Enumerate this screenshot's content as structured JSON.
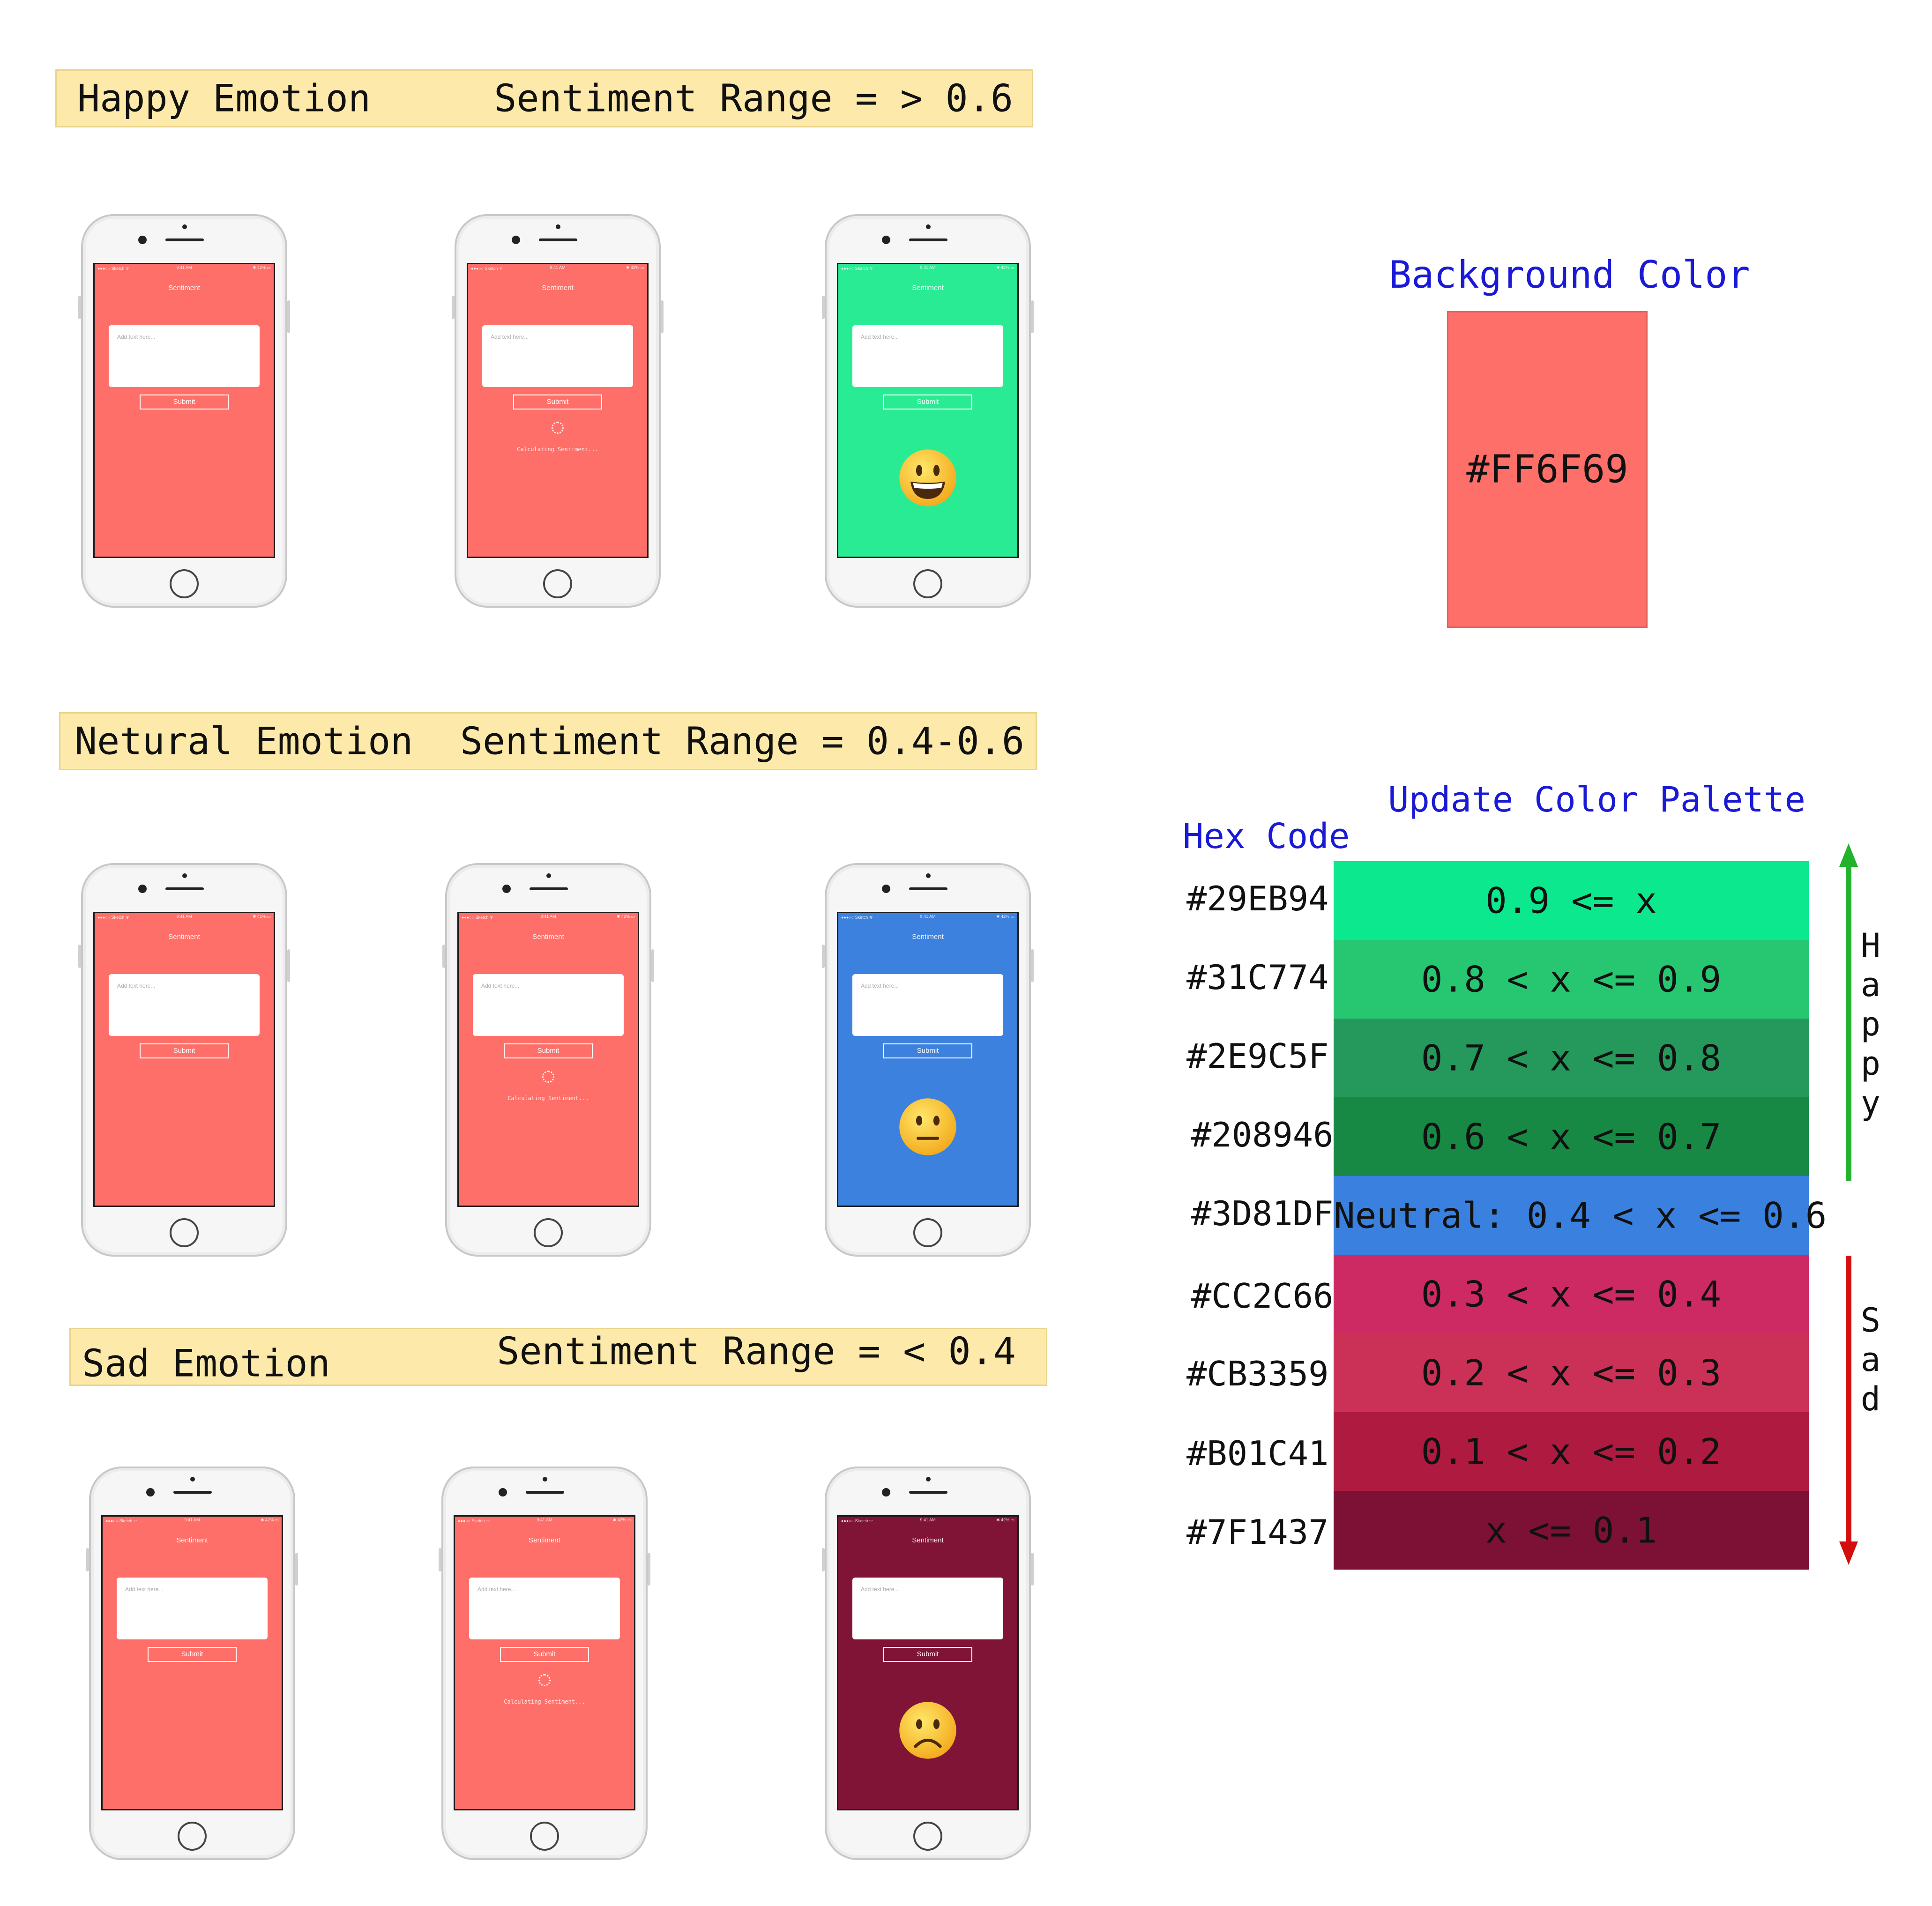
{
  "banners": {
    "happy": {
      "left": "Happy Emotion",
      "right": "Sentiment Range = > 0.6"
    },
    "neutral": {
      "left": "Netural Emotion",
      "right": "Sentiment Range = 0.4-0.6"
    },
    "sad": {
      "left": "Sad Emotion",
      "right": "Sentiment Range = < 0.4"
    }
  },
  "phone_ui": {
    "status_left": "●●●○○ Sketch ᯤ",
    "status_center": "9:41 AM",
    "status_right": "✱ 42% ▭",
    "app_title": "Sentiment",
    "placeholder": "Add text here...",
    "submit_label": "Submit",
    "calculating_text": "Calculating Sentiment..."
  },
  "colors": {
    "default_bg": "#FF6F69",
    "happy_bg": "#29EB94",
    "neutral_bg": "#3D81DF",
    "sad_bg": "#7F1437",
    "happy_arrow": "#22b22b",
    "sad_arrow": "#d40d0d",
    "title_blue": "#1a1ad6",
    "banner_bg": "#fdeaaa"
  },
  "emojis": {
    "happy": "grinning-face-icon",
    "neutral": "neutral-face-icon",
    "sad": "frowning-face-icon"
  },
  "background_section": {
    "title": "Background Color",
    "swatch_hex": "#FF6F69"
  },
  "palette_section": {
    "title": "Update Color Palette",
    "hex_header": "Hex Code",
    "rows": [
      {
        "hex": "#29EB94",
        "color": "#0BE88E",
        "label": "0.9 <= x"
      },
      {
        "hex": "#31C774",
        "color": "#27C772",
        "label": "0.8 < x <= 0.9"
      },
      {
        "hex": "#2E9C5F",
        "color": "#25985C",
        "label": "0.7 < x <= 0.8"
      },
      {
        "hex": "#208946",
        "color": "#178944",
        "label": "0.6 < x <= 0.7"
      },
      {
        "hex": "#3D81DF",
        "color": "#3A80DF",
        "label": "Neutral: 0.4 < x <= 0.6"
      },
      {
        "hex": "#CC2C66",
        "color": "#CD2A63",
        "label": "0.3 < x <= 0.4"
      },
      {
        "hex": "#CB3359",
        "color": "#CB3057",
        "label": "0.2 < x <= 0.3"
      },
      {
        "hex": "#B01C41",
        "color": "#AE1A40",
        "label": "0.1 < x <= 0.2"
      },
      {
        "hex": "#7F1437",
        "color": "#7D1135",
        "label": "x <= 0.1"
      }
    ],
    "happy_letters": [
      "H",
      "a",
      "p",
      "p",
      "y"
    ],
    "sad_letters": [
      "S",
      "a",
      "d"
    ]
  }
}
